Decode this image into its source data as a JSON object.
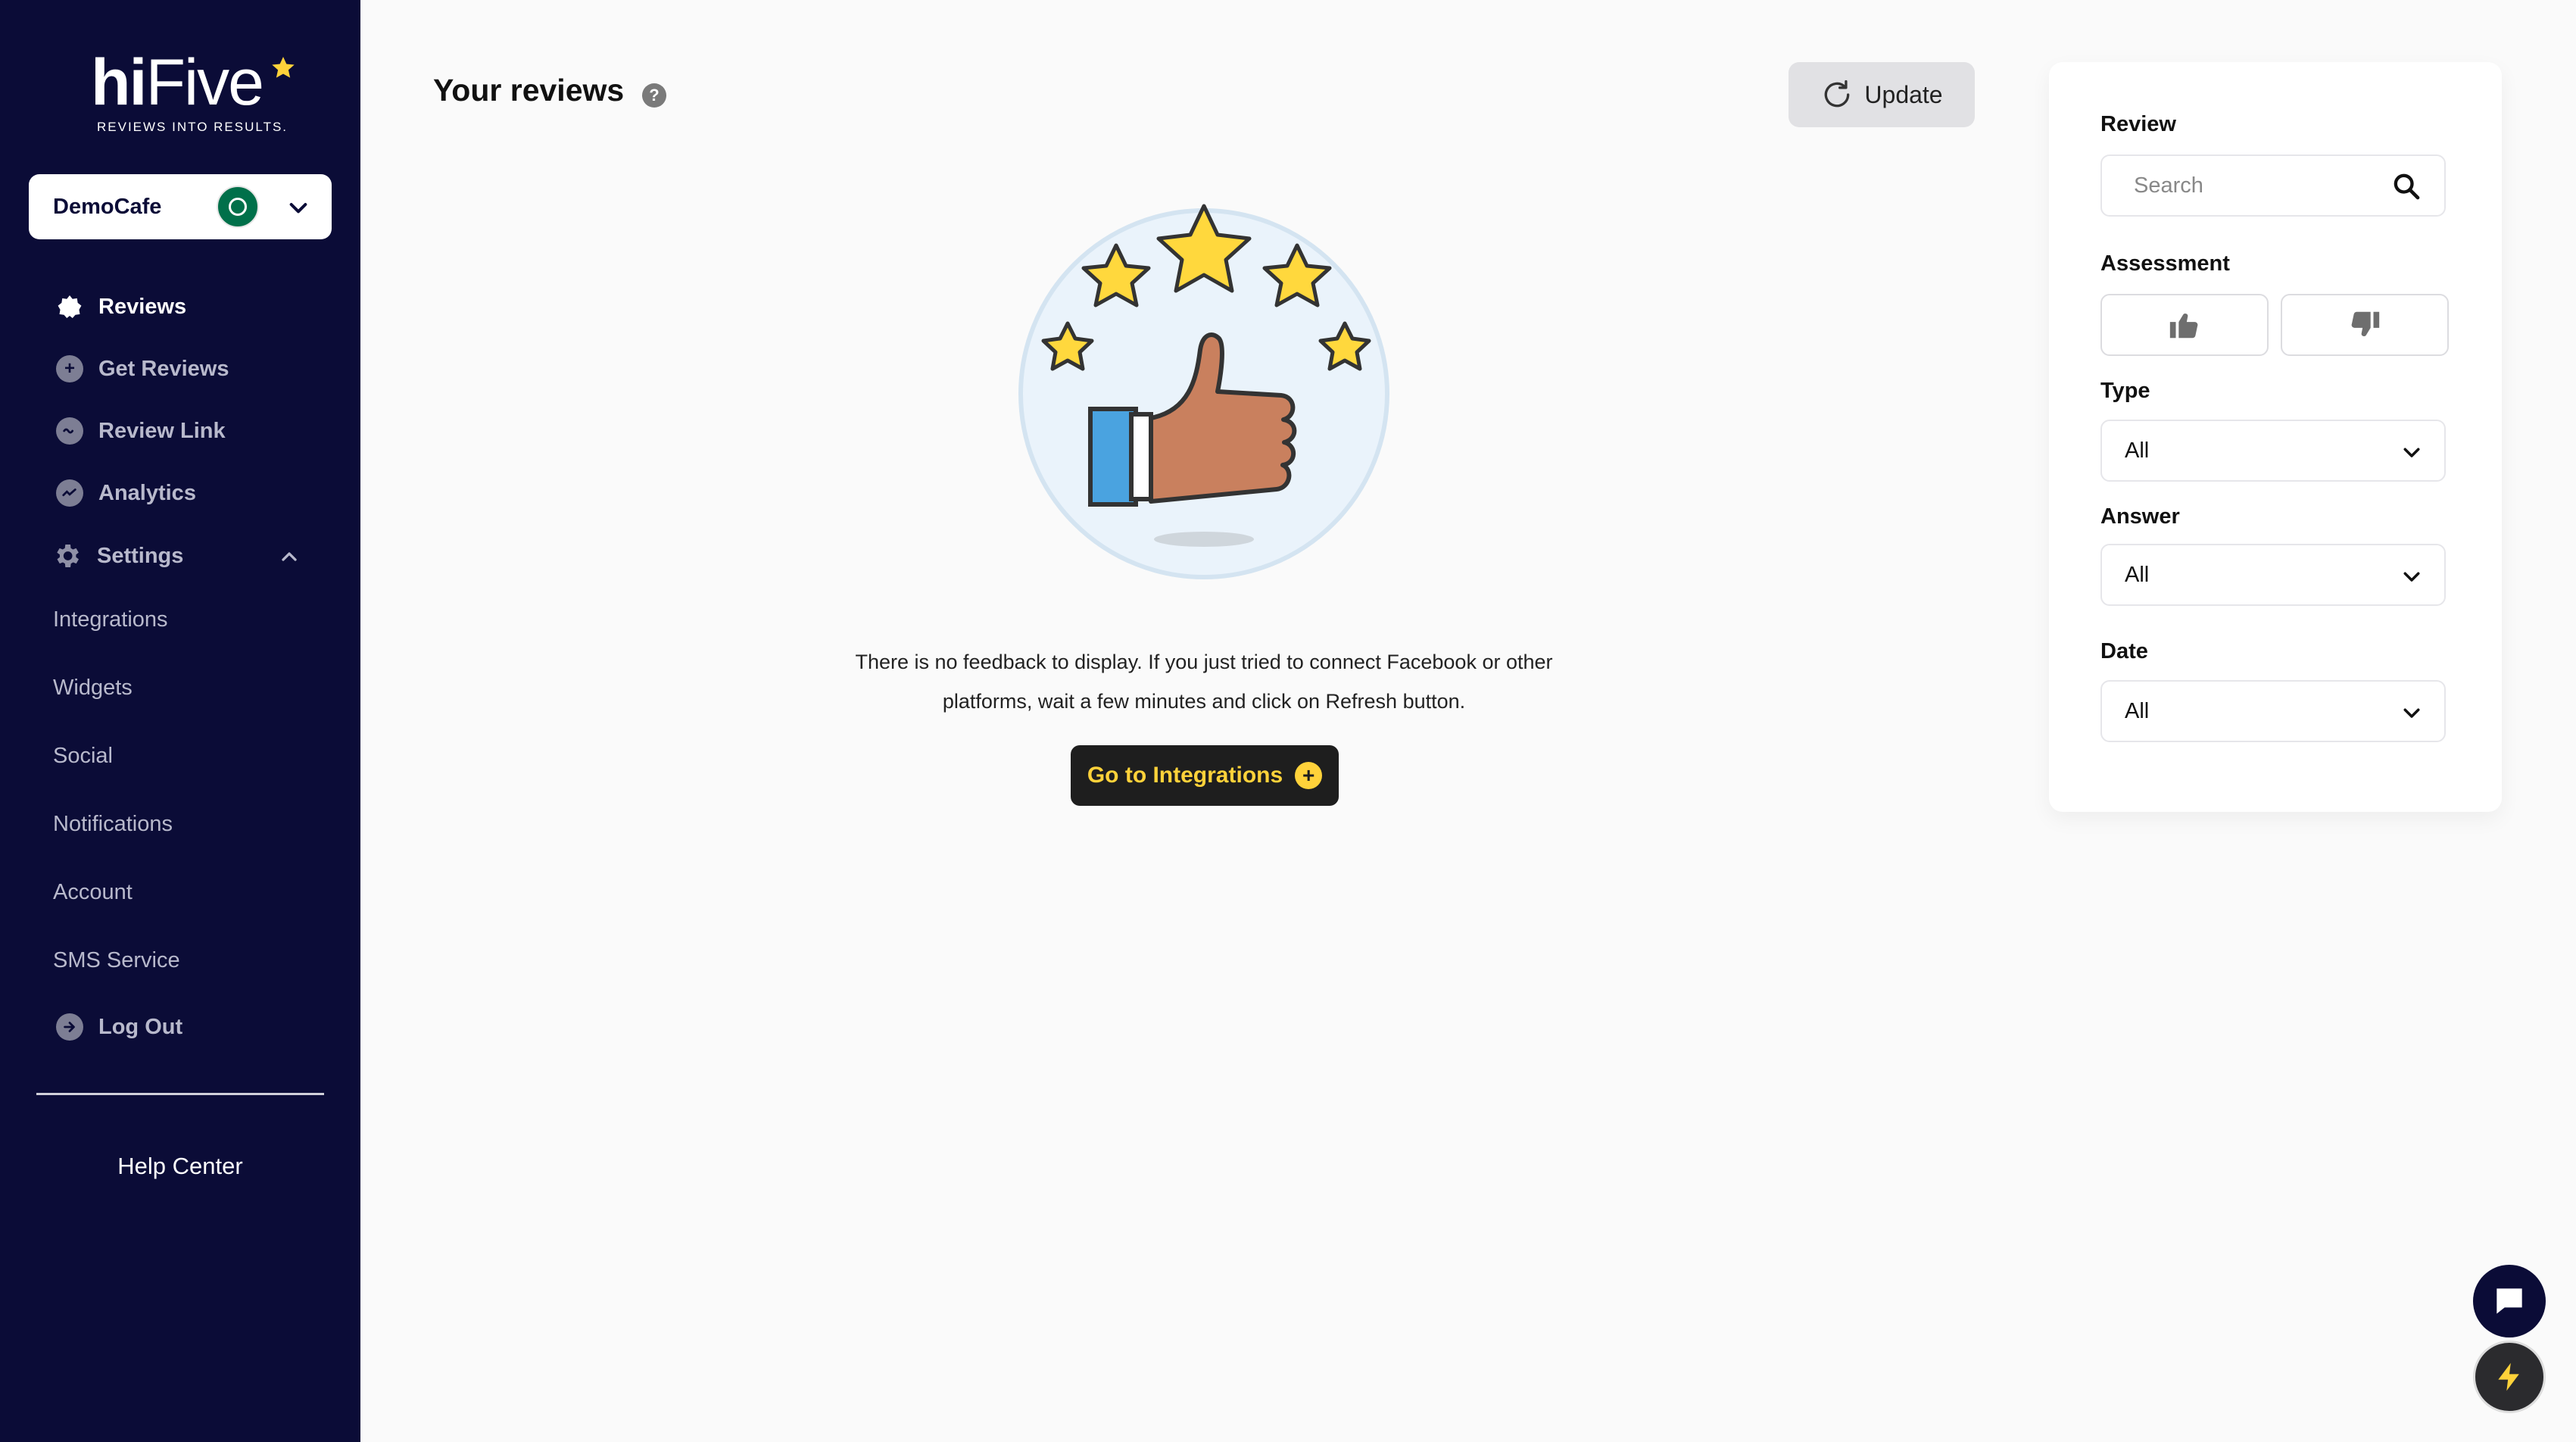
{
  "brand": {
    "logo_text_bold": "hi",
    "logo_text_regular": "Five",
    "tagline": "REVIEWS INTO RESULTS."
  },
  "account": {
    "name": "DemoCafe"
  },
  "nav": {
    "items": [
      {
        "label": "Reviews",
        "icon": "star-badge-icon"
      },
      {
        "label": "Get Reviews",
        "icon": "plus-circle-icon"
      },
      {
        "label": "Review Link",
        "icon": "chat-icon"
      },
      {
        "label": "Analytics",
        "icon": "chart-icon"
      },
      {
        "label": "Settings",
        "icon": "gear-icon"
      }
    ],
    "settings_sub": [
      "Integrations",
      "Widgets",
      "Social",
      "Notifications",
      "Account",
      "SMS Service"
    ],
    "logout": "Log Out",
    "help": "Help Center"
  },
  "main": {
    "title": "Your reviews",
    "help_icon": "?",
    "update_label": "Update",
    "empty_text_line1": "There is no feedback to display. If you just tried to connect Facebook or other",
    "empty_text_line2": "platforms, wait a few minutes and click on Refresh button.",
    "cta_label": "Go to Integrations",
    "cta_icon": "+"
  },
  "filters": {
    "review_label": "Review",
    "search_placeholder": "Search",
    "assessment_label": "Assessment",
    "type_label": "Type",
    "type_value": "All",
    "answer_label": "Answer",
    "answer_value": "All",
    "date_label": "Date",
    "date_value": "All"
  },
  "colors": {
    "sidebar_bg": "#0b0c37",
    "accent_yellow": "#ffd23a",
    "cta_bg": "#1e1e1e"
  }
}
